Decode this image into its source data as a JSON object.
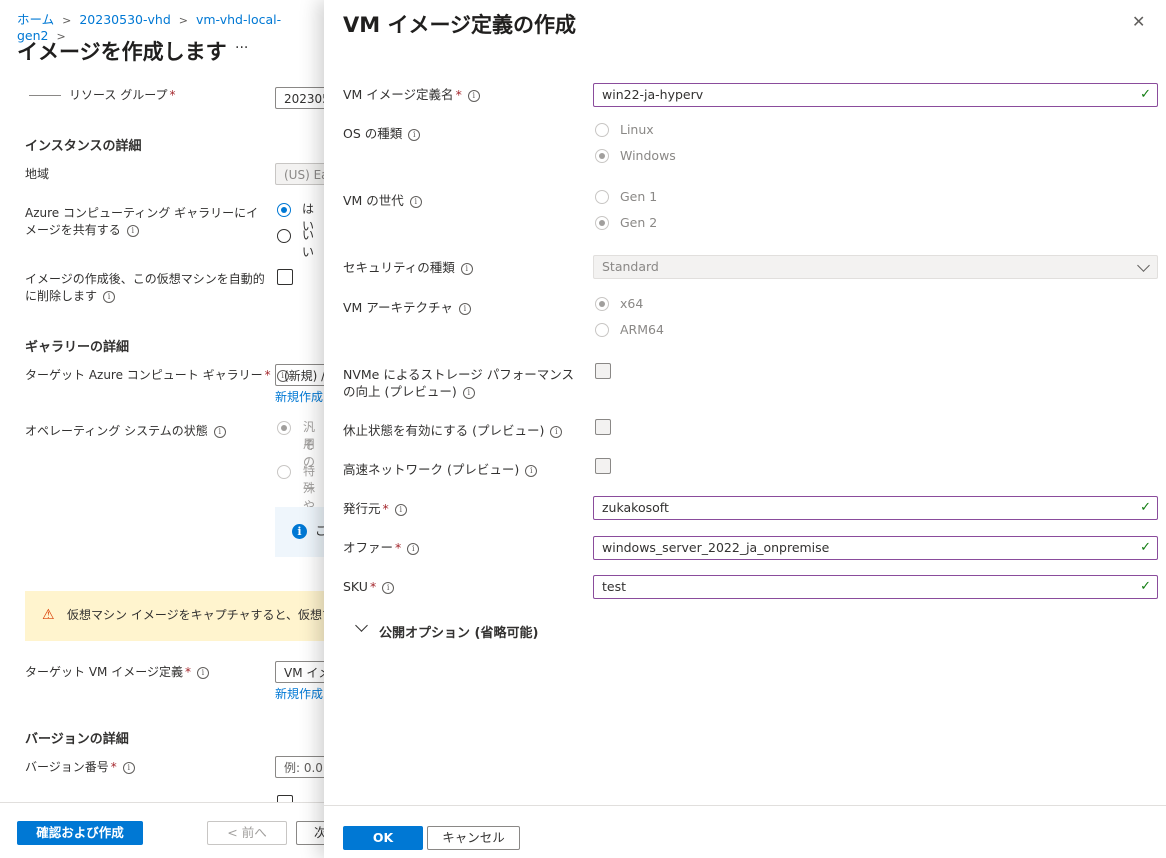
{
  "breadcrumb": [
    "ホーム",
    "20230530-vhd",
    "vm-vhd-local-gen2"
  ],
  "background": {
    "title": "イメージを作成します",
    "more": "···",
    "resource_group_label": "リソース グループ",
    "resource_group_value": "202305",
    "instance_section": "インスタンスの詳細",
    "region_label": "地域",
    "region_value": "(US) Ea",
    "share_label": "Azure コンピューティング ギャラリーにイメージを共有する",
    "share_yes": "はい",
    "share_no": "いい",
    "autodelete_label": "イメージの作成後、この仮想マシンを自動的に削除します",
    "gallery_section": "ギャラリーの詳細",
    "target_gallery_label": "ターゲット Azure コンピュート ギャラリー",
    "target_gallery_value": "(新規) /",
    "create_new_link": "新規作成",
    "os_state_label": "オペレーティング システムの状態",
    "os_state_opt1a": "汎用",
    "os_state_opt1b": "その",
    "os_state_opt2a": "特殊",
    "os_state_opt2b": "ーや",
    "info_box_text": "こ",
    "warning_text": "仮想マシン イメージをキャプチャすると、仮想マシンが使用",
    "target_def_label": "ターゲット VM イメージ定義",
    "target_def_value": "VM イメ",
    "create_new_link2": "新規作成",
    "version_section": "バージョンの詳細",
    "version_label": "バージョン番号",
    "version_placeholder": "例: 0.0."
  },
  "footer": {
    "review_create": "確認および作成",
    "prev": "< 前へ",
    "next": "次"
  },
  "panel": {
    "title": "VM イメージ定義の作成",
    "close": "✕",
    "def_name_label": "VM イメージ定義名",
    "def_name_value": "win22-ja-hyperv",
    "os_type_label": "OS の種類",
    "os_linux": "Linux",
    "os_windows": "Windows",
    "gen_label": "VM の世代",
    "gen1": "Gen 1",
    "gen2": "Gen 2",
    "security_label": "セキュリティの種類",
    "security_value": "Standard",
    "arch_label": "VM アーキテクチャ",
    "arch_x64": "x64",
    "arch_arm64": "ARM64",
    "nvme_label": "NVMe によるストレージ パフォーマンスの向上 (プレビュー)",
    "hibernate_label": "休止状態を有効にする (プレビュー)",
    "accel_label": "高速ネットワーク (プレビュー)",
    "publisher_label": "発行元",
    "publisher_value": "zukakosoft",
    "offer_label": "オファー",
    "offer_value": "windows_server_2022_ja_onpremise",
    "sku_label": "SKU",
    "sku_value": "test",
    "publish_options": "公開オプション (省略可能)",
    "ok": "OK",
    "cancel": "キャンセル"
  }
}
